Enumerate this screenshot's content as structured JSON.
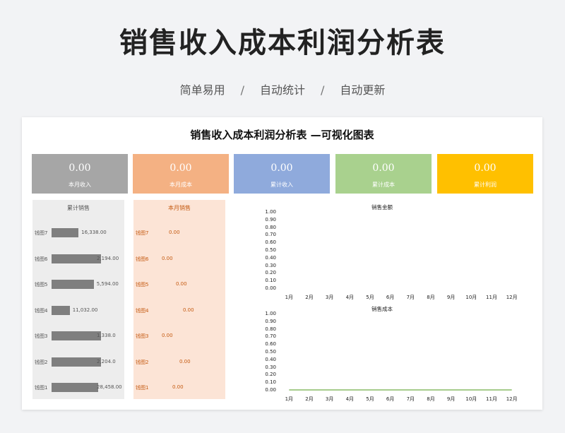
{
  "header": {
    "title": "销售收入成本利润分析表",
    "subtitle_items": [
      "简单易用",
      "自动统计",
      "自动更新"
    ],
    "separator": "/"
  },
  "panel": {
    "title": "销售收入成本利润分析表 —可视化图表"
  },
  "cards": [
    {
      "value": "0.00",
      "label": "本月收入",
      "color": "#a6a6a6"
    },
    {
      "value": "0.00",
      "label": "本月成本",
      "color": "#f4b183"
    },
    {
      "value": "0.00",
      "label": "累计收入",
      "color": "#8faadc"
    },
    {
      "value": "0.00",
      "label": "累计成本",
      "color": "#a9d18e"
    },
    {
      "value": "0.00",
      "label": "累计利润",
      "color": "#ffc000"
    }
  ],
  "cumulative_sales": {
    "title": "累计销售",
    "bg_color": "#ededed",
    "max": 30000,
    "rows": [
      {
        "name": "钱图7",
        "label": "16,338.00",
        "value": 16338
      },
      {
        "name": "钱图6",
        "label": "2,194.00",
        "value": 32194
      },
      {
        "name": "钱图5",
        "label": "5,594.00",
        "value": 25594
      },
      {
        "name": "钱图4",
        "label": "11,032.00",
        "value": 11032
      },
      {
        "name": "钱图3",
        "label": "1,338.0",
        "value": 31338
      },
      {
        "name": "钱图2",
        "label": "2,204.0",
        "value": 32204
      },
      {
        "name": "钱图1",
        "label": "28,458.00",
        "value": 28458
      }
    ]
  },
  "monthly_sales": {
    "title": "本月销售",
    "bg_color": "#fce4d6",
    "text_color": "#c55a11",
    "rows": [
      {
        "name": "钱图7",
        "label": "0.00"
      },
      {
        "name": "钱图6",
        "label": "0.00"
      },
      {
        "name": "钱图5",
        "label": "0.00"
      },
      {
        "name": "钱图4",
        "label": "0.00"
      },
      {
        "name": "钱图3",
        "label": "0.00"
      },
      {
        "name": "钱图2",
        "label": "0.00"
      },
      {
        "name": "钱图1",
        "label": "0.00"
      }
    ]
  },
  "chart_data": [
    {
      "type": "line",
      "title": "销售金额",
      "categories": [
        "1月",
        "2月",
        "3月",
        "4月",
        "5月",
        "6月",
        "7月",
        "8月",
        "9月",
        "10月",
        "11月",
        "12月"
      ],
      "yticks": [
        "1.00",
        "0.90",
        "0.80",
        "0.70",
        "0.60",
        "0.50",
        "0.40",
        "0.30",
        "0.20",
        "0.10",
        "0.00"
      ],
      "ylim": [
        0,
        1
      ],
      "series": [
        {
          "values": [
            0,
            0,
            0,
            0,
            0,
            0,
            0,
            0,
            0,
            0,
            0,
            0
          ],
          "color": "#ffffff"
        }
      ]
    },
    {
      "type": "line",
      "title": "销售成本",
      "categories": [
        "1月",
        "2月",
        "3月",
        "4月",
        "5月",
        "6月",
        "7月",
        "8月",
        "9月",
        "10月",
        "11月",
        "12月"
      ],
      "yticks": [
        "1.00",
        "0.90",
        "0.80",
        "0.70",
        "0.60",
        "0.50",
        "0.40",
        "0.30",
        "0.20",
        "0.10",
        "0.00"
      ],
      "ylim": [
        0,
        1
      ],
      "series": [
        {
          "values": [
            0,
            0,
            0,
            0,
            0,
            0,
            0,
            0,
            0,
            0,
            0,
            0
          ],
          "color": "#70ad47"
        }
      ]
    }
  ]
}
